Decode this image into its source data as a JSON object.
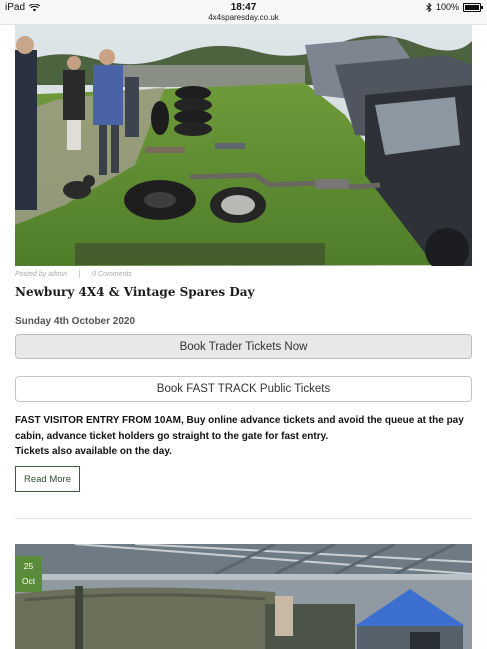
{
  "status_bar": {
    "device": "iPad",
    "time": "18:47",
    "url": "4x4sparesday.co.uk",
    "battery": "100%"
  },
  "icons": {
    "wifi": "wifi-icon",
    "bluetooth": "bluetooth-icon",
    "battery": "battery-icon"
  },
  "post": {
    "posted_by": "Posted by admin",
    "comments": "0 Comments",
    "title": "Newbury 4X4 & Vintage Spares Day",
    "date": "Sunday 4th October 2020",
    "trader_button": "Book Trader Tickets Now",
    "public_button": "Book FAST TRACK Public Tickets",
    "description_line1": "FAST VISITOR ENTRY FROM 10AM, Buy online advance tickets and avoid the queue at the pay cabin, advance ticket holders go straight to the gate for fast entry.",
    "description_line2": "Tickets also available on the day.",
    "read_more": "Read More"
  },
  "next_post": {
    "day": "25",
    "month": "Oct"
  },
  "colors": {
    "accent_green": "#5b8c3c",
    "read_more_border": "#3c5e3c",
    "trader_button_bg": "#e8e8e8"
  }
}
